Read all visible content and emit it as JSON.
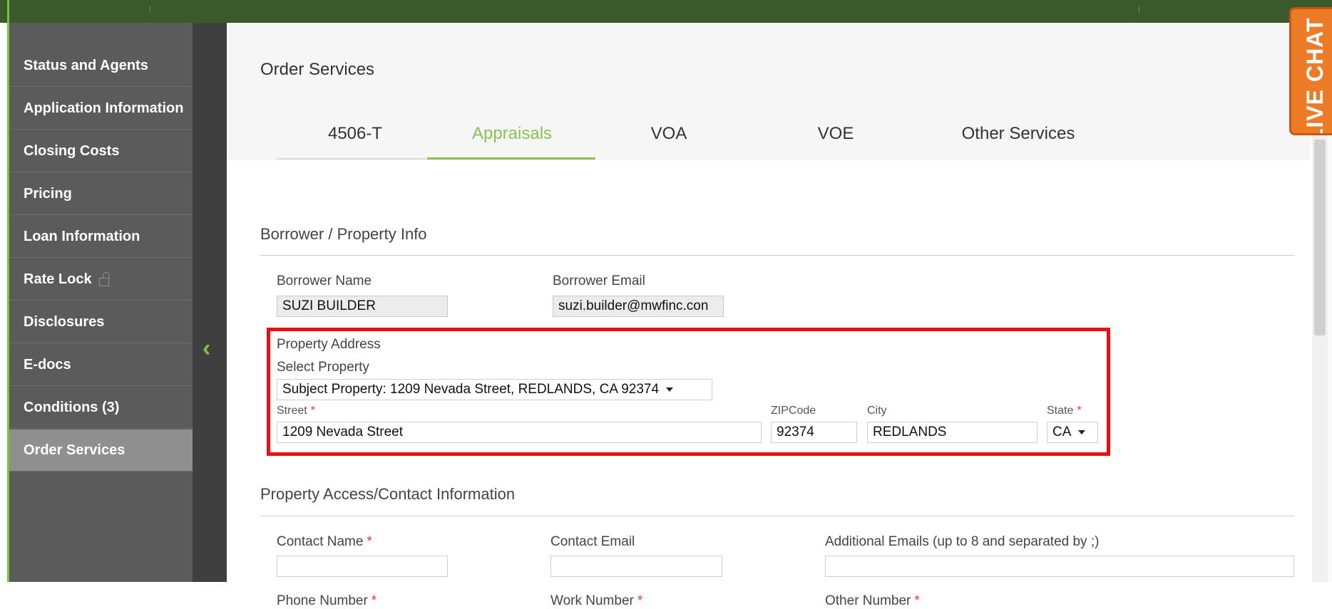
{
  "sidebar": {
    "items": [
      {
        "label": "Status and Agents"
      },
      {
        "label": "Application Information"
      },
      {
        "label": "Closing Costs"
      },
      {
        "label": "Pricing"
      },
      {
        "label": "Loan Information"
      },
      {
        "label": "Rate Lock"
      },
      {
        "label": "Disclosures"
      },
      {
        "label": "E-docs"
      },
      {
        "label": "Conditions (3)"
      },
      {
        "label": "Order Services"
      }
    ],
    "active": "Order Services",
    "rate_lock_icon": "unlocked-padlock-icon"
  },
  "collapse": {
    "icon": "chevron-left-icon",
    "glyph": "‹"
  },
  "main": {
    "title": "Order Services",
    "tabs": [
      {
        "label": "4506-T"
      },
      {
        "label": "Appraisals"
      },
      {
        "label": "VOA"
      },
      {
        "label": "VOE"
      },
      {
        "label": "Other Services"
      }
    ],
    "active_tab": "Appraisals"
  },
  "borrower_section": {
    "title": "Borrower / Property Info",
    "borrower_name_label": "Borrower Name",
    "borrower_name": "SUZI BUILDER",
    "borrower_email_label": "Borrower Email",
    "borrower_email": "suzi.builder@mwfinc.con",
    "property_address_label": "Property Address",
    "select_property_label": "Select Property",
    "select_property_value": "Subject Property: 1209 Nevada Street, REDLANDS, CA 92374",
    "street_label": "Street",
    "street_value": "1209 Nevada Street",
    "zip_label": "ZIPCode",
    "zip_value": "92374",
    "city_label": "City",
    "city_value": "REDLANDS",
    "state_label": "State",
    "state_value": "CA",
    "required_mark": "*"
  },
  "contact_section": {
    "title": "Property Access/Contact Information",
    "contact_name_label": "Contact Name",
    "contact_email_label": "Contact Email",
    "additional_emails_label": "Additional Emails (up to 8 and separated by ;)",
    "phone_label": "Phone Number",
    "work_label": "Work Number",
    "other_label": "Other Number",
    "required_mark": "*"
  },
  "live_chat": {
    "label": "LIVE CHAT"
  },
  "colors": {
    "accent_green": "#8cc152",
    "sidebar_bg": "#5b5b5b",
    "sidebar_active": "#8f8f8f",
    "highlight_red": "#ec0e12",
    "live_chat_orange": "#ec7a26",
    "required_red": "#e53b3b"
  }
}
